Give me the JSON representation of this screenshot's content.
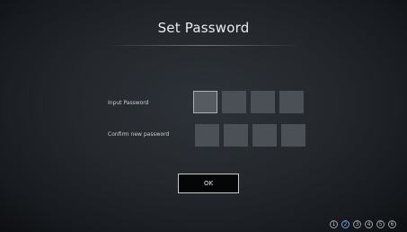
{
  "title": "Set Password",
  "fields": {
    "input_label": "Input Password",
    "confirm_label": "Confirm new password"
  },
  "ok_label": "OK",
  "steps": [
    "1",
    "2",
    "3",
    "4",
    "5",
    "6"
  ],
  "current_step": 2,
  "colors": {
    "active_box_border": "#8fb4e0",
    "step_current": "#6f9fe6"
  }
}
